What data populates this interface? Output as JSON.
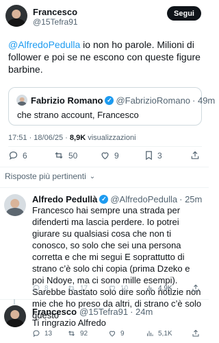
{
  "main_tweet": {
    "author_name": "Francesco",
    "author_handle": "@15Tefra91",
    "follow_label": "Segui",
    "mention": "@AlfredoPedulla",
    "text": " io non ho parole. Milioni di follower e poi se ne escono con queste figure barbine.",
    "quote": {
      "name": "Fabrizio Romano",
      "handle": "@FabrizioRomano",
      "time": "· 49m",
      "text": "che strano account, Francesco"
    },
    "timestamp": "17:51 · 18/06/25 · ",
    "views_count": "8,9K",
    "views_label": " visualizzazioni",
    "stats": {
      "replies": "6",
      "retweets": "50",
      "likes": "9",
      "bookmarks": "3"
    }
  },
  "replies_section": {
    "title": "Risposte più pertinenti"
  },
  "replies": [
    {
      "name": "Alfredo Pedullà",
      "handle": "@AlfredoPedulla",
      "time": "· 25m",
      "text": "Francesco hai sempre una strada per difenderti ma lascia perdere. Io potrei giurare su qualsiasi cosa che non ti conosco, so solo che sei una persona corretta e che mi segui E soprattutto di strano c’è solo chi copia (prima Dzeko e poi Ndoye, ma ci sono mille esempi). Sarebbe bastato solo dire sono notizie non mie che ho preso da altri, di strano c’è solo questo",
      "stats": {
        "replies": "8",
        "retweets": "17",
        "likes": "10",
        "views": "4,9K"
      }
    },
    {
      "name": "Francesco",
      "handle": "@15Tefra91",
      "time": "· 24m",
      "text": "Ti ringrazio Alfredo",
      "stats": {
        "replies": "13",
        "retweets": "92",
        "likes": "9",
        "views": "5,1K"
      }
    }
  ],
  "colors": {
    "accent": "#1d9bf0",
    "text": "#0f1419",
    "secondary": "#536471",
    "border": "#cfd9de"
  }
}
